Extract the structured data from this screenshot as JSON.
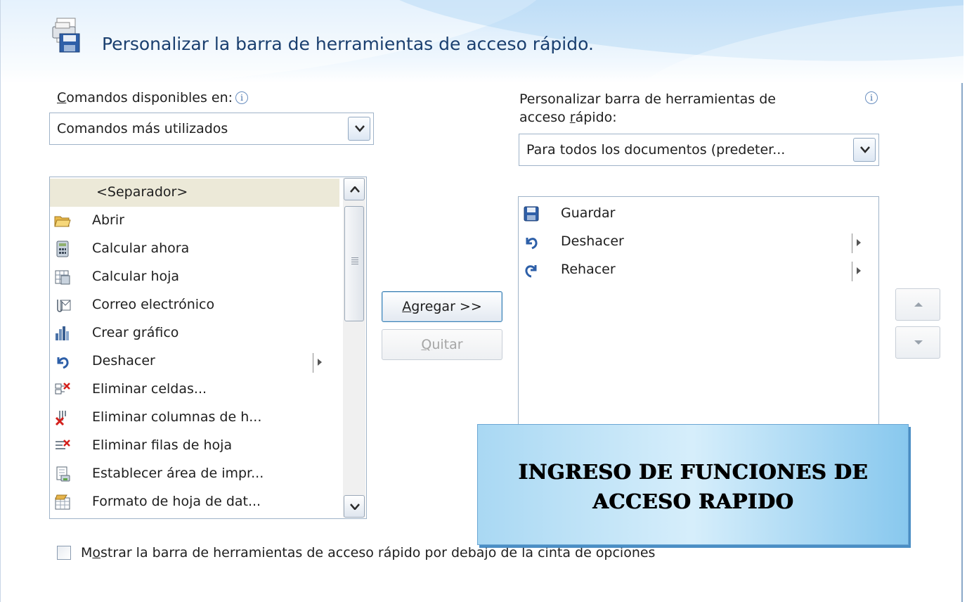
{
  "dialog": {
    "title": "Personalizar la barra de herramientas de acceso rápido."
  },
  "left": {
    "label_first": "C",
    "label_rest": "omandos disponibles en:",
    "combo_value": "Comandos más utilizados",
    "items": [
      {
        "label": "<Separador>",
        "icon": "separator",
        "submenu": false
      },
      {
        "label": "Abrir",
        "icon": "open-folder-icon",
        "submenu": false
      },
      {
        "label": "Calcular ahora",
        "icon": "calculator-icon",
        "submenu": false
      },
      {
        "label": "Calcular hoja",
        "icon": "sheet-calc-icon",
        "submenu": false
      },
      {
        "label": "Correo electrónico",
        "icon": "email-attachment-icon",
        "submenu": false
      },
      {
        "label": "Crear gráfico",
        "icon": "chart-icon",
        "submenu": false
      },
      {
        "label": "Deshacer",
        "icon": "undo-icon",
        "submenu": true
      },
      {
        "label": "Eliminar celdas...",
        "icon": "delete-cells-icon",
        "submenu": false
      },
      {
        "label": "Eliminar columnas de h...",
        "icon": "delete-columns-icon",
        "submenu": false
      },
      {
        "label": "Eliminar filas de hoja",
        "icon": "delete-rows-icon",
        "submenu": false
      },
      {
        "label": "Establecer área de impr...",
        "icon": "print-area-icon",
        "submenu": false
      },
      {
        "label": "Formato de hoja de dat...",
        "icon": "datasheet-format-icon",
        "submenu": false
      }
    ]
  },
  "right": {
    "label_line1": "Personalizar barra de herramientas de",
    "label_line2_pre": "acceso ",
    "label_line2_u": "r",
    "label_line2_post": "ápido:",
    "combo_value": "Para todos los documentos (predeter...",
    "items": [
      {
        "label": "Guardar",
        "icon": "save-icon",
        "submenu": false
      },
      {
        "label": "Deshacer",
        "icon": "undo-icon",
        "submenu": true
      },
      {
        "label": "Rehacer",
        "icon": "redo-icon",
        "submenu": true
      }
    ]
  },
  "buttons": {
    "add_u": "A",
    "add_rest": "gregar >>",
    "remove_u": "Q",
    "remove_rest": "uitar"
  },
  "checkbox": {
    "label_pre": "M",
    "label_u": "o",
    "label_post": "strar la barra de herramientas de acceso rápido por debajo de la cinta de opciones",
    "checked": false
  },
  "overlay": {
    "line1": "INGRESO DE FUNCIONES DE",
    "line2": "ACCESO RAPIDO"
  },
  "info_glyph": "i"
}
